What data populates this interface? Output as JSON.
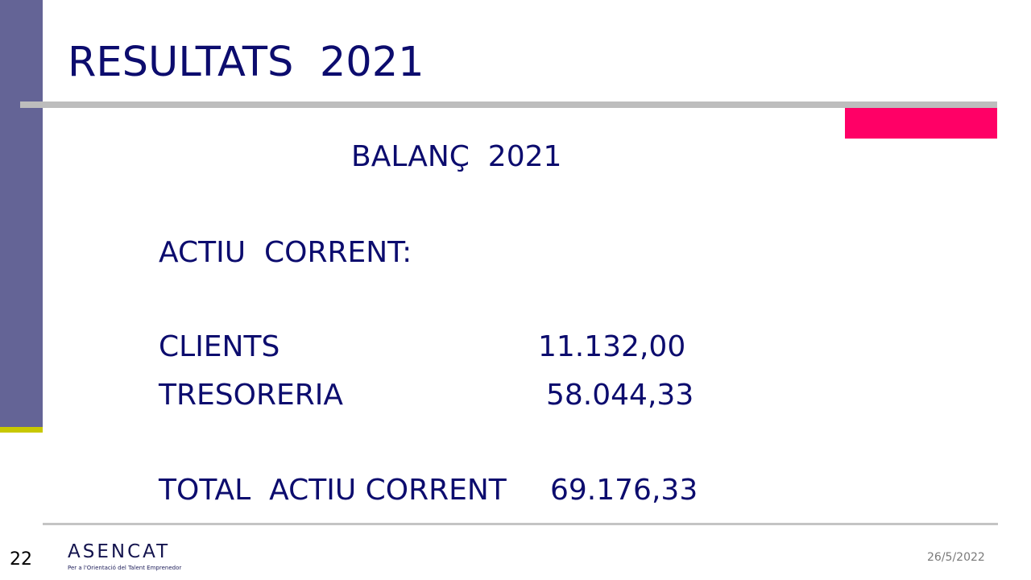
{
  "slide": {
    "title": "RESULTATS  2021",
    "subtitle": "BALANÇ  2021",
    "section_heading": "ACTIU  CORRENT:",
    "rows": [
      {
        "label": "CLIENTS",
        "value": "11.132,00"
      },
      {
        "label": "TRESORERIA",
        "value": "58.044,33"
      },
      {
        "label": "TOTAL  ACTIU CORRENT",
        "value": "69.176,33"
      }
    ]
  },
  "footer": {
    "page_number": "22",
    "logo_name": "ASENCAT",
    "logo_tagline": "Per a l'Orientació del Talent Emprenedor",
    "date": "26/5/2022"
  },
  "colors": {
    "sidebar": "#646496",
    "sidebar_accent": "#c8c800",
    "text": "#0c0c6e",
    "pink_accent": "#ff0066",
    "rule": "#bdbdbd"
  }
}
